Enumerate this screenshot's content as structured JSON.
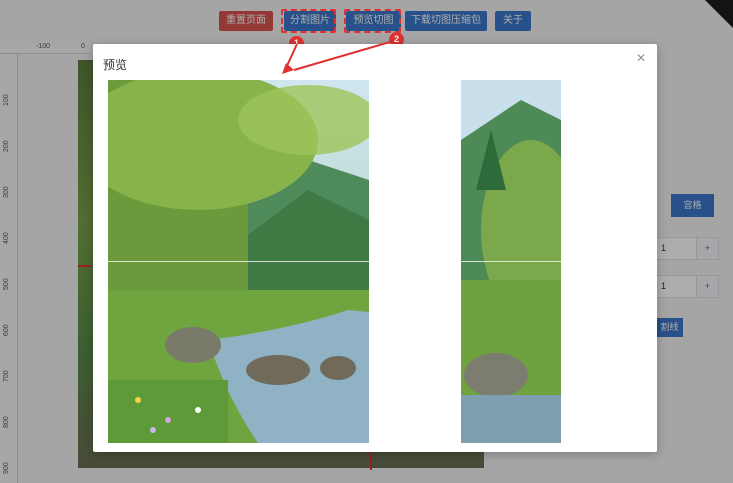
{
  "toolbar": {
    "reset_label": "重置页面",
    "split_label": "分割图片",
    "preview_label": "预览切图",
    "download_label": "下载切图压缩包",
    "about_label": "关于"
  },
  "annotations": {
    "badge_1": "1",
    "badge_2": "2",
    "color": "#e03131"
  },
  "ruler": {
    "top_ticks": [
      "-100",
      "0"
    ],
    "left_ticks": [
      "100",
      "200",
      "300",
      "400",
      "500",
      "600",
      "700",
      "800",
      "900"
    ]
  },
  "side_panel": {
    "grid_button_label": "宫格",
    "grid_fragment": "]",
    "rows_value": "1",
    "cols_value": "1",
    "plus_label": "+",
    "line_button_label": "割线"
  },
  "modal": {
    "title": "预览",
    "close_icon": "close-icon"
  },
  "colors": {
    "primary": "#3a78c9",
    "danger": "#d9534f"
  }
}
